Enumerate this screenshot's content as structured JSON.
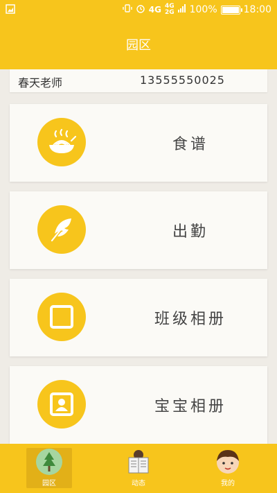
{
  "status_bar": {
    "network_top": "4G",
    "network_mid": "4G",
    "network_bottom": "2G",
    "net_label": "4G",
    "battery": "100%",
    "battery_level": 1.0,
    "time": "18:00"
  },
  "header": {
    "title": "园区"
  },
  "teacher": {
    "name": "春天老师",
    "phone": "13555550025"
  },
  "menu": [
    {
      "label": "食谱",
      "icon": "noodle-bowl-icon"
    },
    {
      "label": "出勤",
      "icon": "feather-icon"
    },
    {
      "label": "班级相册",
      "icon": "photo-frame-icon"
    },
    {
      "label": "宝宝相册",
      "icon": "baby-photo-icon"
    }
  ],
  "tabs": [
    {
      "label": "园区",
      "icon": "tree-icon",
      "active": true
    },
    {
      "label": "动态",
      "icon": "newspaper-reader-icon",
      "active": false
    },
    {
      "label": "我的",
      "icon": "boy-face-icon",
      "active": false
    }
  ],
  "colors": {
    "primary": "#f7c51c",
    "background": "#efece6",
    "card": "#fbfaf6"
  }
}
